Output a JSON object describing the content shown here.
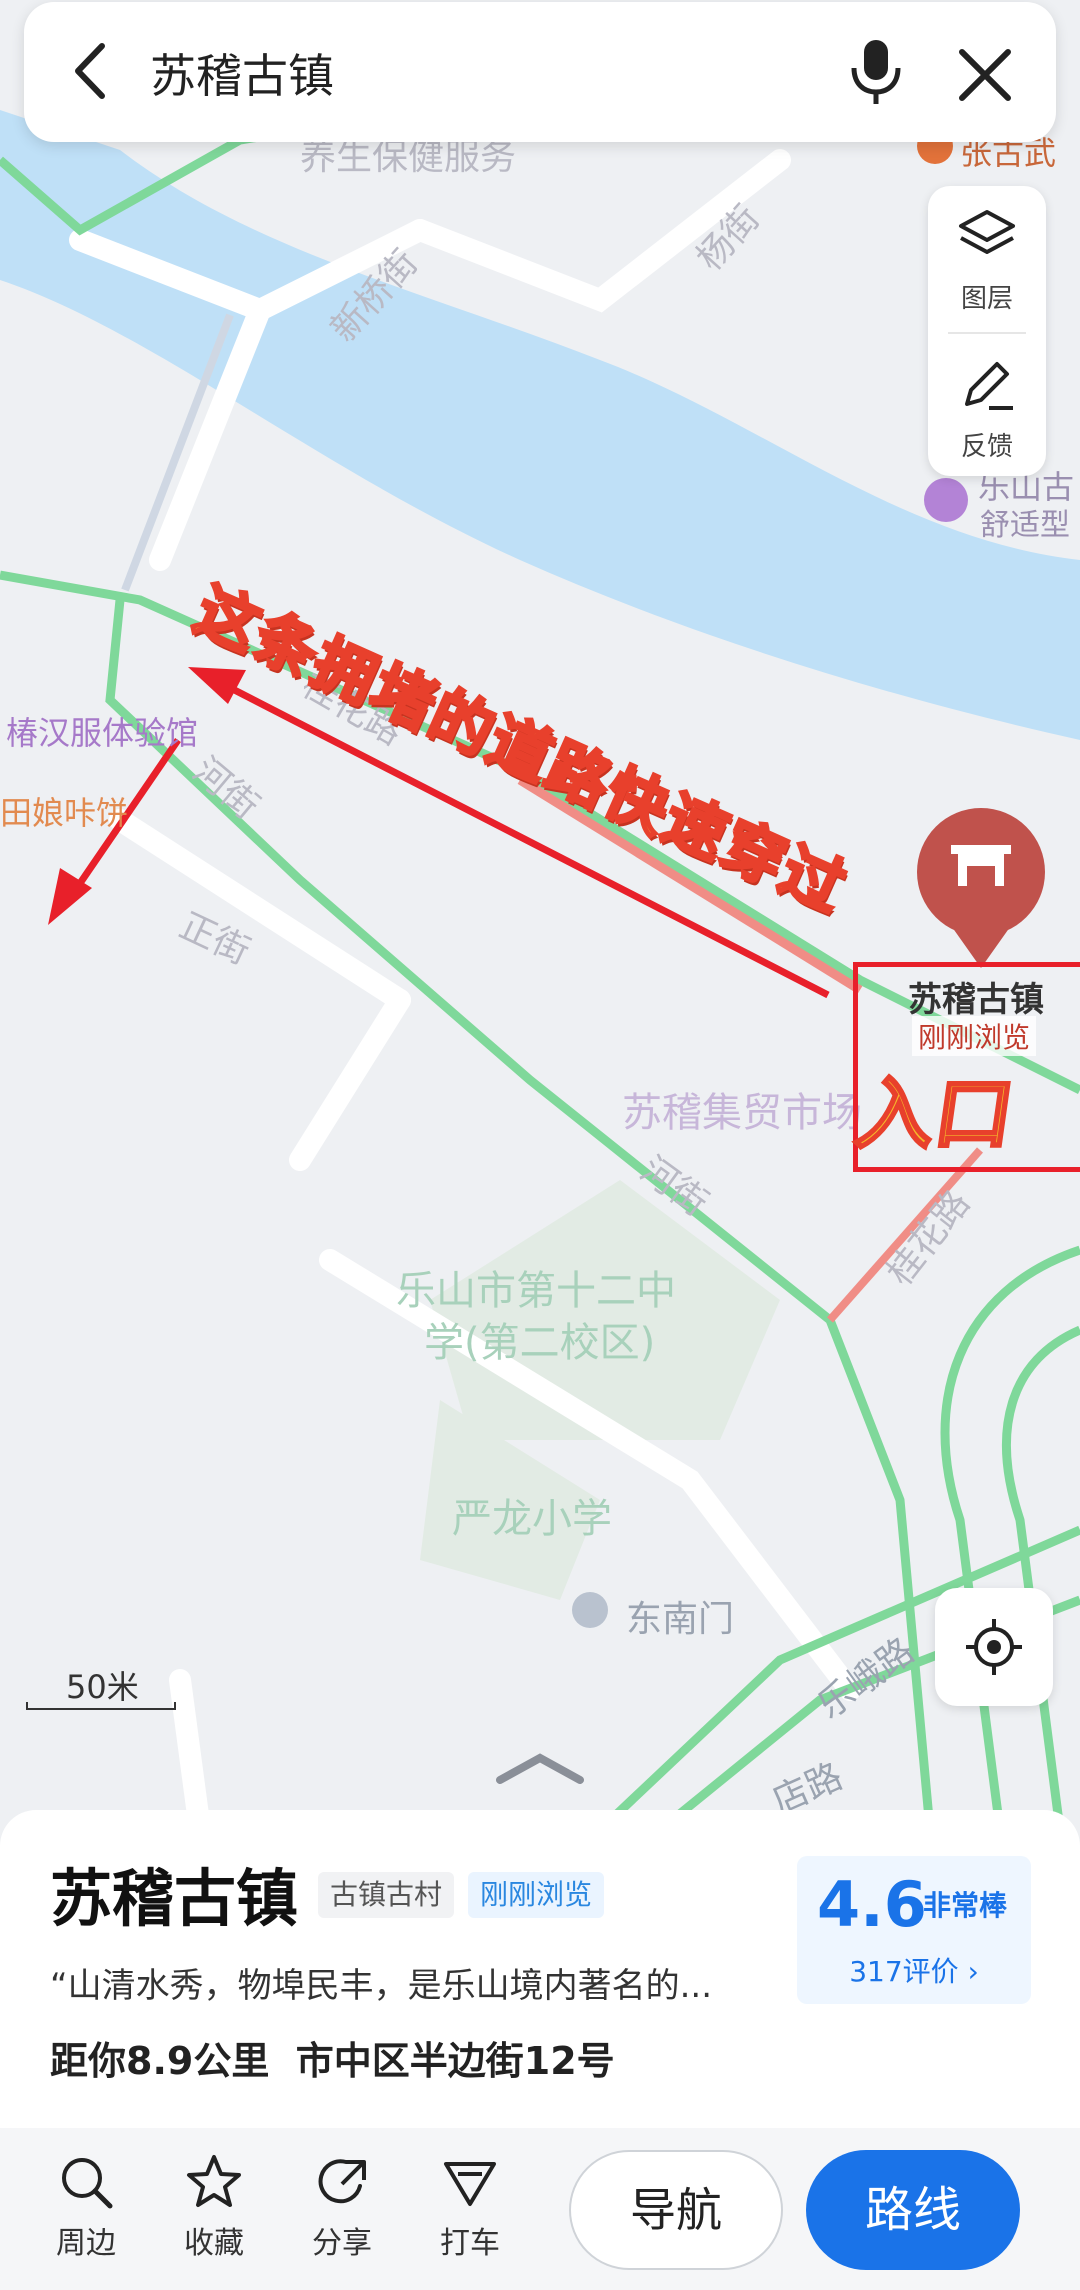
{
  "search": {
    "query": "苏稽古镇"
  },
  "layers_panel": {
    "layers_label": "图层",
    "feedback_label": "反馈"
  },
  "map": {
    "labels": {
      "health_service": "养生保健服务",
      "xinqiao_street": "新桥街",
      "yang_street": "杨街",
      "guihua_road": "桂花路",
      "he_street": "河街",
      "zheng_street": "正街",
      "he_street_2": "河街",
      "guihua_road_2": "桂花路",
      "leshan_school": "乐山市第十二中",
      "leshan_school_2": "学(第二校区)",
      "yanlong_school": "严龙小学",
      "southeast_gate": "东南门",
      "le_e_road": "乐峨路",
      "market": "苏稽集贸市场",
      "hanfu_shop": "椿汉服体验馆",
      "bing_shop": "田娘咔饼",
      "hotel_name": "乐山古",
      "hotel_type": "舒适型",
      "zhang_shop": "张古武",
      "scale": "50米",
      "bottom_road": "店路"
    },
    "annotation": "这条拥堵的道路快速穿过",
    "entrance_label": "入口",
    "pin": {
      "name": "苏稽古镇",
      "badge": "刚刚浏览"
    }
  },
  "place": {
    "name": "苏稽古镇",
    "tags": [
      "古镇古村",
      "刚刚浏览"
    ],
    "description": "“山清水秀，物埠民丰，是乐山境内著名的...",
    "distance": "距你8.9公里",
    "address": "市中区半边街12号",
    "rating": {
      "score": "4.6",
      "word": "非常棒",
      "count": "317评价 ›"
    }
  },
  "toolbar": {
    "nearby": "周边",
    "favorite": "收藏",
    "share": "分享",
    "taxi": "打车",
    "navigate": "导航",
    "route": "路线"
  },
  "colors": {
    "accent": "#1a73e8",
    "road_green": "#7fd89a",
    "river": "#bfe0f7",
    "annotation_red": "#e8202a"
  }
}
